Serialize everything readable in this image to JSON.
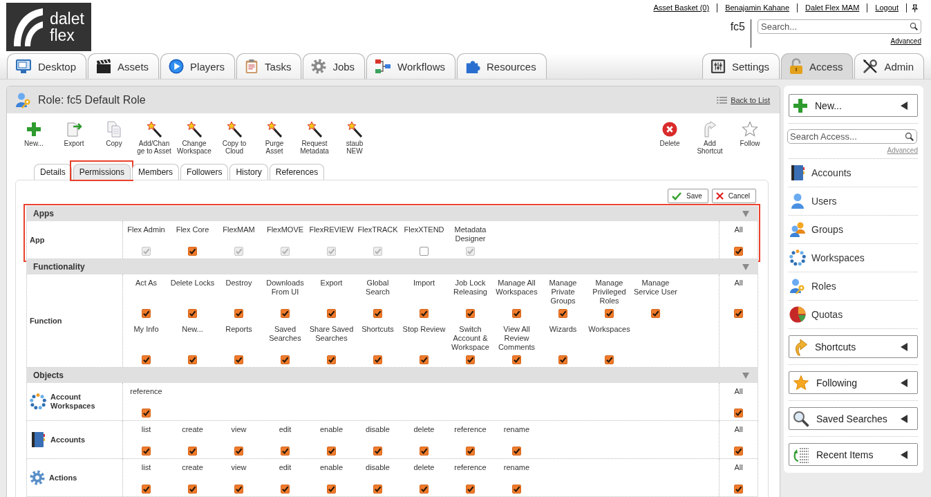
{
  "header": {
    "logo_text": "dalet flex",
    "user_links": [
      "Asset Basket (0)",
      "Benajamin Kahane",
      "Dalet Flex MAM",
      "Logout"
    ],
    "account": "fc5",
    "search": {
      "placeholder": "Search..."
    },
    "advanced_link": "Advanced"
  },
  "main_tabs": [
    {
      "label": "Desktop",
      "selected": false
    },
    {
      "label": "Assets",
      "selected": false
    },
    {
      "label": "Players",
      "selected": false
    },
    {
      "label": "Tasks",
      "selected": false
    },
    {
      "label": "Jobs",
      "selected": false
    },
    {
      "label": "Workflows",
      "selected": false
    },
    {
      "label": "Resources",
      "selected": false
    }
  ],
  "admin_tabs": [
    {
      "label": "Settings",
      "selected": false
    },
    {
      "label": "Access",
      "selected": true
    },
    {
      "label": "Admin",
      "selected": false
    }
  ],
  "role_panel": {
    "title": "Role: fc5 Default Role",
    "back_link": "Back to List",
    "toolbar": [
      {
        "lines": [
          "New..."
        ]
      },
      {
        "lines": [
          "Export"
        ]
      },
      {
        "lines": [
          "Copy"
        ]
      },
      {
        "lines": [
          "Add/Chan",
          "ge to Asset"
        ]
      },
      {
        "lines": [
          "Change",
          "Workspace"
        ]
      },
      {
        "lines": [
          "Copy to",
          "Cloud"
        ]
      },
      {
        "lines": [
          "Purge",
          "Asset"
        ]
      },
      {
        "lines": [
          "Request",
          "Metadata"
        ]
      },
      {
        "lines": [
          "staub",
          "NEW"
        ]
      }
    ],
    "toolbar_right": [
      {
        "lines": [
          "Delete"
        ]
      },
      {
        "lines": [
          "Add",
          "Shortcut"
        ]
      },
      {
        "lines": [
          "Follow"
        ]
      }
    ],
    "tabs": [
      {
        "label": "Details",
        "selected": false,
        "highlighted": false
      },
      {
        "label": "Permissions",
        "selected": true,
        "highlighted": true
      },
      {
        "label": "Members",
        "selected": false,
        "highlighted": false
      },
      {
        "label": "Followers",
        "selected": false,
        "highlighted": false
      },
      {
        "label": "History",
        "selected": false,
        "highlighted": false
      },
      {
        "label": "References",
        "selected": false,
        "highlighted": false
      }
    ],
    "buttons": [
      "Save",
      "Cancel"
    ],
    "sections": [
      {
        "title": "Apps",
        "expanded": true,
        "highlighted": true,
        "rows": [
          {
            "label": "App",
            "permissions": [
              {
                "label": "Flex Admin",
                "checked": true,
                "disabled": true
              },
              {
                "label": "Flex Core",
                "checked": true,
                "disabled": false
              },
              {
                "label": "FlexMAM",
                "checked": true,
                "disabled": true
              },
              {
                "label": "FlexMOVE",
                "checked": true,
                "disabled": true
              },
              {
                "label": "FlexREVIEW",
                "checked": true,
                "disabled": true
              },
              {
                "label": "FlexTRACK",
                "checked": true,
                "disabled": true
              },
              {
                "label": "FlexXTEND",
                "checked": false,
                "disabled": false
              },
              {
                "label": "Metadata Designer",
                "checked": true,
                "disabled": true
              }
            ],
            "all": {
              "label": "All",
              "checked": true,
              "disabled": false
            }
          }
        ]
      },
      {
        "title": "Functionality",
        "expanded": true,
        "highlighted": false,
        "rows": [
          {
            "label": "Function",
            "permissions": [
              {
                "label": "Act As",
                "checked": true,
                "disabled": false
              },
              {
                "label": "Delete Locks",
                "checked": true,
                "disabled": false
              },
              {
                "label": "Destroy",
                "checked": true,
                "disabled": false
              },
              {
                "label": "Downloads From UI",
                "checked": true,
                "disabled": false
              },
              {
                "label": "Export",
                "checked": true,
                "disabled": false
              },
              {
                "label": "Global Search",
                "checked": true,
                "disabled": false
              },
              {
                "label": "Import",
                "checked": true,
                "disabled": false
              },
              {
                "label": "Job Lock Releasing",
                "checked": true,
                "disabled": false
              },
              {
                "label": "Manage All Workspaces",
                "checked": true,
                "disabled": false
              },
              {
                "label": "Manage Private Groups",
                "checked": true,
                "disabled": false
              },
              {
                "label": "Manage Privileged Roles",
                "checked": true,
                "disabled": false
              },
              {
                "label": "Manage Service User",
                "checked": true,
                "disabled": false
              },
              {
                "label": "My Info",
                "checked": true,
                "disabled": false
              },
              {
                "label": "New...",
                "checked": true,
                "disabled": false
              },
              {
                "label": "Reports",
                "checked": true,
                "disabled": false
              },
              {
                "label": "Saved Searches",
                "checked": true,
                "disabled": false
              },
              {
                "label": "Share Saved Searches",
                "checked": true,
                "disabled": false
              },
              {
                "label": "Shortcuts",
                "checked": true,
                "disabled": false
              },
              {
                "label": "Stop Review",
                "checked": true,
                "disabled": false
              },
              {
                "label": "Switch Account & Workspace",
                "checked": true,
                "disabled": false
              },
              {
                "label": "View All Review Comments",
                "checked": true,
                "disabled": false
              },
              {
                "label": "Wizards",
                "checked": true,
                "disabled": false
              },
              {
                "label": "Workspaces",
                "checked": true,
                "disabled": false
              }
            ],
            "all": {
              "label": "All",
              "checked": true,
              "disabled": false
            }
          }
        ]
      },
      {
        "title": "Objects",
        "expanded": true,
        "highlighted": false,
        "rows": [
          {
            "label": "Account Workspaces",
            "permissions": [
              {
                "label": "reference",
                "checked": true,
                "disabled": false
              }
            ],
            "all": {
              "label": "All",
              "checked": true,
              "disabled": false
            }
          },
          {
            "label": "Accounts",
            "permissions": [
              {
                "label": "list",
                "checked": true,
                "disabled": false
              },
              {
                "label": "create",
                "checked": true,
                "disabled": false
              },
              {
                "label": "view",
                "checked": true,
                "disabled": false
              },
              {
                "label": "edit",
                "checked": true,
                "disabled": false
              },
              {
                "label": "enable",
                "checked": true,
                "disabled": false
              },
              {
                "label": "disable",
                "checked": true,
                "disabled": false
              },
              {
                "label": "delete",
                "checked": true,
                "disabled": false
              },
              {
                "label": "reference",
                "checked": true,
                "disabled": false
              },
              {
                "label": "rename",
                "checked": true,
                "disabled": false
              }
            ],
            "all": {
              "label": "All",
              "checked": true,
              "disabled": false
            }
          },
          {
            "label": "Actions",
            "permissions": [
              {
                "label": "list",
                "checked": true,
                "disabled": false
              },
              {
                "label": "create",
                "checked": true,
                "disabled": false
              },
              {
                "label": "view",
                "checked": true,
                "disabled": false
              },
              {
                "label": "edit",
                "checked": true,
                "disabled": false
              },
              {
                "label": "enable",
                "checked": true,
                "disabled": false
              },
              {
                "label": "disable",
                "checked": true,
                "disabled": false
              },
              {
                "label": "delete",
                "checked": true,
                "disabled": false
              },
              {
                "label": "reference",
                "checked": true,
                "disabled": false
              },
              {
                "label": "rename",
                "checked": true,
                "disabled": false
              }
            ],
            "all": {
              "label": "All",
              "checked": true,
              "disabled": false
            }
          }
        ]
      }
    ]
  },
  "sidebar": {
    "new_button": {
      "label": "New...",
      "expanded": false
    },
    "search": {
      "placeholder": "Search Access..."
    },
    "advanced_link": "Advanced",
    "items": [
      "Accounts",
      "Users",
      "Groups",
      "Workspaces",
      "Roles",
      "Quotas"
    ],
    "panels": [
      {
        "label": "Shortcuts",
        "expanded": false
      },
      {
        "label": "Following",
        "expanded": false
      },
      {
        "label": "Saved Searches",
        "expanded": false
      },
      {
        "label": "Recent Items",
        "expanded": false
      }
    ]
  }
}
